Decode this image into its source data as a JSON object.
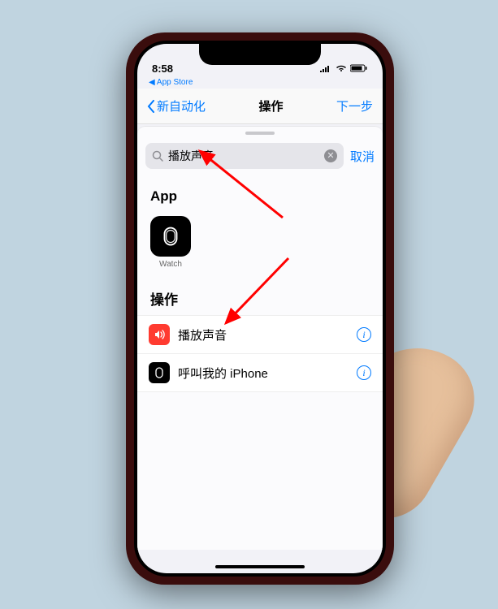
{
  "status": {
    "time": "8:58",
    "breadcrumb": "◀ App Store"
  },
  "nav": {
    "back": "新自动化",
    "title": "操作",
    "next": "下一步"
  },
  "search": {
    "value": "播放声音",
    "cancel": "取消"
  },
  "sections": {
    "app": {
      "header": "App",
      "items": [
        {
          "label": "Watch"
        }
      ]
    },
    "actions": {
      "header": "操作",
      "items": [
        {
          "label": "播放声音",
          "color": "red",
          "icon": "speaker"
        },
        {
          "label": "呼叫我的 iPhone",
          "color": "black",
          "icon": "watch"
        }
      ]
    }
  }
}
